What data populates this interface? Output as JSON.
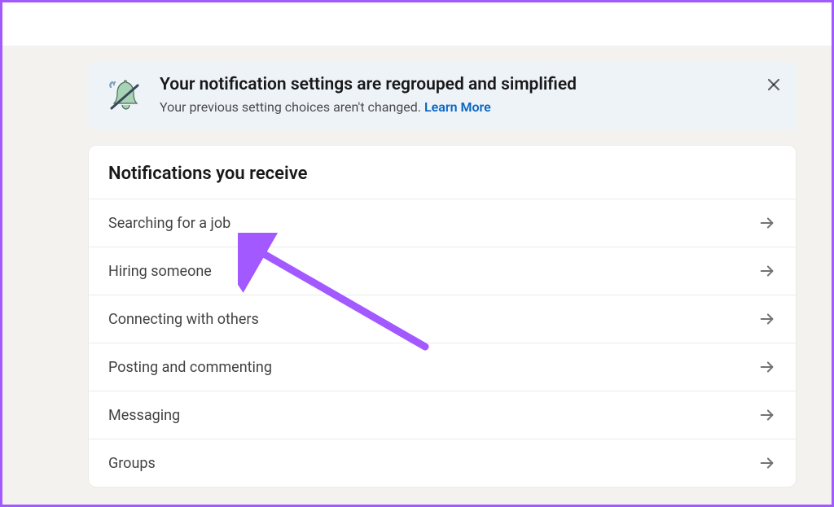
{
  "banner": {
    "title": "Your notification settings are regrouped and simplified",
    "subtitle": "Your previous setting choices aren't changed. ",
    "learn_more": "Learn More"
  },
  "section": {
    "title": "Notifications you receive",
    "items": [
      {
        "label": "Searching for a job"
      },
      {
        "label": "Hiring someone"
      },
      {
        "label": "Connecting with others"
      },
      {
        "label": "Posting and commenting"
      },
      {
        "label": "Messaging"
      },
      {
        "label": "Groups"
      }
    ]
  }
}
